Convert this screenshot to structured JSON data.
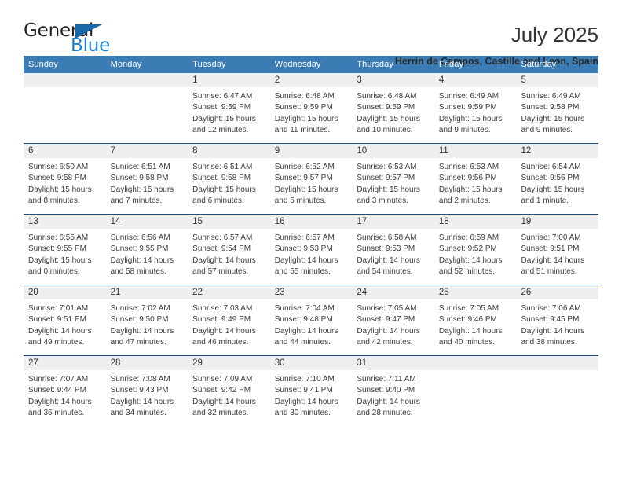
{
  "brand": {
    "name_part1": "General",
    "name_part2": "Blue",
    "triangle_color": "#1668a8",
    "blue_color": "#1f7fc4"
  },
  "header": {
    "title": "July 2025",
    "location": "Herrin de Campos, Castille and Leon, Spain"
  },
  "theme": {
    "header_bar": "#3b7cb5",
    "week_divider": "#1c4f80",
    "daynum_band": "#efefef",
    "text": "#3c3c3c"
  },
  "weekdays": [
    "Sunday",
    "Monday",
    "Tuesday",
    "Wednesday",
    "Thursday",
    "Friday",
    "Saturday"
  ],
  "weeks": [
    [
      {
        "day": "",
        "empty": true,
        "sunrise": "",
        "sunset": "",
        "daylight1": "",
        "daylight2": ""
      },
      {
        "day": "",
        "empty": true,
        "sunrise": "",
        "sunset": "",
        "daylight1": "",
        "daylight2": ""
      },
      {
        "day": "1",
        "sunrise": "Sunrise: 6:47 AM",
        "sunset": "Sunset: 9:59 PM",
        "daylight1": "Daylight: 15 hours",
        "daylight2": "and 12 minutes."
      },
      {
        "day": "2",
        "sunrise": "Sunrise: 6:48 AM",
        "sunset": "Sunset: 9:59 PM",
        "daylight1": "Daylight: 15 hours",
        "daylight2": "and 11 minutes."
      },
      {
        "day": "3",
        "sunrise": "Sunrise: 6:48 AM",
        "sunset": "Sunset: 9:59 PM",
        "daylight1": "Daylight: 15 hours",
        "daylight2": "and 10 minutes."
      },
      {
        "day": "4",
        "sunrise": "Sunrise: 6:49 AM",
        "sunset": "Sunset: 9:59 PM",
        "daylight1": "Daylight: 15 hours",
        "daylight2": "and 9 minutes."
      },
      {
        "day": "5",
        "sunrise": "Sunrise: 6:49 AM",
        "sunset": "Sunset: 9:58 PM",
        "daylight1": "Daylight: 15 hours",
        "daylight2": "and 9 minutes."
      }
    ],
    [
      {
        "day": "6",
        "sunrise": "Sunrise: 6:50 AM",
        "sunset": "Sunset: 9:58 PM",
        "daylight1": "Daylight: 15 hours",
        "daylight2": "and 8 minutes."
      },
      {
        "day": "7",
        "sunrise": "Sunrise: 6:51 AM",
        "sunset": "Sunset: 9:58 PM",
        "daylight1": "Daylight: 15 hours",
        "daylight2": "and 7 minutes."
      },
      {
        "day": "8",
        "sunrise": "Sunrise: 6:51 AM",
        "sunset": "Sunset: 9:58 PM",
        "daylight1": "Daylight: 15 hours",
        "daylight2": "and 6 minutes."
      },
      {
        "day": "9",
        "sunrise": "Sunrise: 6:52 AM",
        "sunset": "Sunset: 9:57 PM",
        "daylight1": "Daylight: 15 hours",
        "daylight2": "and 5 minutes."
      },
      {
        "day": "10",
        "sunrise": "Sunrise: 6:53 AM",
        "sunset": "Sunset: 9:57 PM",
        "daylight1": "Daylight: 15 hours",
        "daylight2": "and 3 minutes."
      },
      {
        "day": "11",
        "sunrise": "Sunrise: 6:53 AM",
        "sunset": "Sunset: 9:56 PM",
        "daylight1": "Daylight: 15 hours",
        "daylight2": "and 2 minutes."
      },
      {
        "day": "12",
        "sunrise": "Sunrise: 6:54 AM",
        "sunset": "Sunset: 9:56 PM",
        "daylight1": "Daylight: 15 hours",
        "daylight2": "and 1 minute."
      }
    ],
    [
      {
        "day": "13",
        "sunrise": "Sunrise: 6:55 AM",
        "sunset": "Sunset: 9:55 PM",
        "daylight1": "Daylight: 15 hours",
        "daylight2": "and 0 minutes."
      },
      {
        "day": "14",
        "sunrise": "Sunrise: 6:56 AM",
        "sunset": "Sunset: 9:55 PM",
        "daylight1": "Daylight: 14 hours",
        "daylight2": "and 58 minutes."
      },
      {
        "day": "15",
        "sunrise": "Sunrise: 6:57 AM",
        "sunset": "Sunset: 9:54 PM",
        "daylight1": "Daylight: 14 hours",
        "daylight2": "and 57 minutes."
      },
      {
        "day": "16",
        "sunrise": "Sunrise: 6:57 AM",
        "sunset": "Sunset: 9:53 PM",
        "daylight1": "Daylight: 14 hours",
        "daylight2": "and 55 minutes."
      },
      {
        "day": "17",
        "sunrise": "Sunrise: 6:58 AM",
        "sunset": "Sunset: 9:53 PM",
        "daylight1": "Daylight: 14 hours",
        "daylight2": "and 54 minutes."
      },
      {
        "day": "18",
        "sunrise": "Sunrise: 6:59 AM",
        "sunset": "Sunset: 9:52 PM",
        "daylight1": "Daylight: 14 hours",
        "daylight2": "and 52 minutes."
      },
      {
        "day": "19",
        "sunrise": "Sunrise: 7:00 AM",
        "sunset": "Sunset: 9:51 PM",
        "daylight1": "Daylight: 14 hours",
        "daylight2": "and 51 minutes."
      }
    ],
    [
      {
        "day": "20",
        "sunrise": "Sunrise: 7:01 AM",
        "sunset": "Sunset: 9:51 PM",
        "daylight1": "Daylight: 14 hours",
        "daylight2": "and 49 minutes."
      },
      {
        "day": "21",
        "sunrise": "Sunrise: 7:02 AM",
        "sunset": "Sunset: 9:50 PM",
        "daylight1": "Daylight: 14 hours",
        "daylight2": "and 47 minutes."
      },
      {
        "day": "22",
        "sunrise": "Sunrise: 7:03 AM",
        "sunset": "Sunset: 9:49 PM",
        "daylight1": "Daylight: 14 hours",
        "daylight2": "and 46 minutes."
      },
      {
        "day": "23",
        "sunrise": "Sunrise: 7:04 AM",
        "sunset": "Sunset: 9:48 PM",
        "daylight1": "Daylight: 14 hours",
        "daylight2": "and 44 minutes."
      },
      {
        "day": "24",
        "sunrise": "Sunrise: 7:05 AM",
        "sunset": "Sunset: 9:47 PM",
        "daylight1": "Daylight: 14 hours",
        "daylight2": "and 42 minutes."
      },
      {
        "day": "25",
        "sunrise": "Sunrise: 7:05 AM",
        "sunset": "Sunset: 9:46 PM",
        "daylight1": "Daylight: 14 hours",
        "daylight2": "and 40 minutes."
      },
      {
        "day": "26",
        "sunrise": "Sunrise: 7:06 AM",
        "sunset": "Sunset: 9:45 PM",
        "daylight1": "Daylight: 14 hours",
        "daylight2": "and 38 minutes."
      }
    ],
    [
      {
        "day": "27",
        "sunrise": "Sunrise: 7:07 AM",
        "sunset": "Sunset: 9:44 PM",
        "daylight1": "Daylight: 14 hours",
        "daylight2": "and 36 minutes."
      },
      {
        "day": "28",
        "sunrise": "Sunrise: 7:08 AM",
        "sunset": "Sunset: 9:43 PM",
        "daylight1": "Daylight: 14 hours",
        "daylight2": "and 34 minutes."
      },
      {
        "day": "29",
        "sunrise": "Sunrise: 7:09 AM",
        "sunset": "Sunset: 9:42 PM",
        "daylight1": "Daylight: 14 hours",
        "daylight2": "and 32 minutes."
      },
      {
        "day": "30",
        "sunrise": "Sunrise: 7:10 AM",
        "sunset": "Sunset: 9:41 PM",
        "daylight1": "Daylight: 14 hours",
        "daylight2": "and 30 minutes."
      },
      {
        "day": "31",
        "sunrise": "Sunrise: 7:11 AM",
        "sunset": "Sunset: 9:40 PM",
        "daylight1": "Daylight: 14 hours",
        "daylight2": "and 28 minutes."
      },
      {
        "day": "",
        "empty": true,
        "sunrise": "",
        "sunset": "",
        "daylight1": "",
        "daylight2": ""
      },
      {
        "day": "",
        "empty": true,
        "sunrise": "",
        "sunset": "",
        "daylight1": "",
        "daylight2": ""
      }
    ]
  ]
}
